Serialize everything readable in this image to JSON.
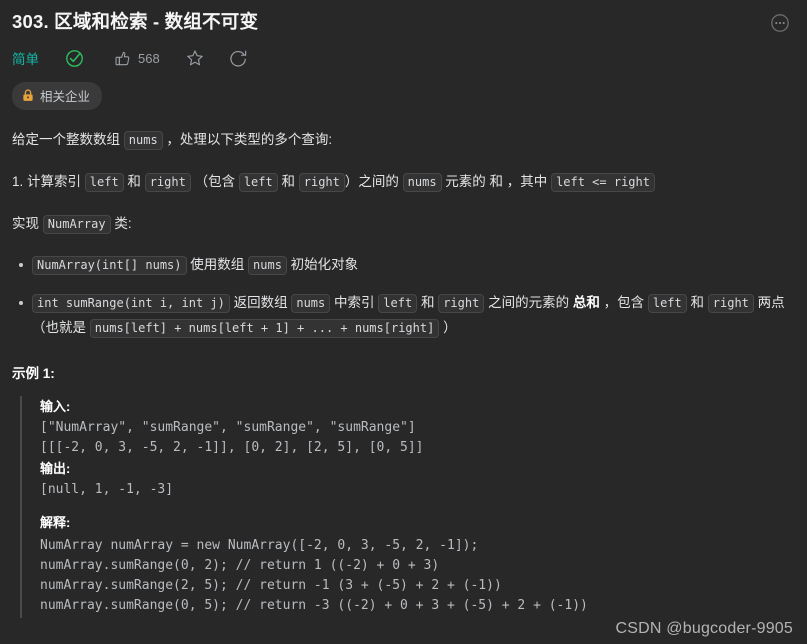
{
  "header": {
    "title": "303. 区域和检索 - 数组不可变",
    "more_icon": "ellipsis-circle-icon"
  },
  "meta": {
    "difficulty": "简单",
    "difficulty_color": "#12b8a6",
    "check_icon": "check-circle-icon",
    "check_color": "#2cbb5d",
    "like_icon": "thumbs-up-icon",
    "like_count": "568",
    "star_icon": "star-icon",
    "share_icon": "share-icon"
  },
  "company_tag": {
    "icon": "lock-icon",
    "icon_color": "#e8a33d",
    "label": "相关企业"
  },
  "description": {
    "intro_a": "给定一个整数数组 ",
    "intro_code": "nums",
    "intro_b": " ，处理以下类型的多个查询:",
    "query_a": "1. 计算索引 ",
    "query_left1": "left",
    "query_b": " 和 ",
    "query_right1": "right",
    "query_c": " （包含 ",
    "query_left2": "left",
    "query_d": " 和 ",
    "query_right2": "right",
    "query_e": "）之间的 ",
    "query_nums": "nums",
    "query_f": " 元素的 和 ，其中 ",
    "query_cond": "left <= right",
    "impl_a": "实现 ",
    "impl_code": "NumArray",
    "impl_b": " 类:"
  },
  "methods": [
    {
      "signature": "NumArray(int[] nums)",
      "text_a": " 使用数组 ",
      "code_b": "nums",
      "text_c": " 初始化对象"
    },
    {
      "signature": "int sumRange(int i, int j)",
      "text_a": " 返回数组 ",
      "code_b": "nums",
      "text_c": " 中索引 ",
      "code_d": "left",
      "text_e": " 和 ",
      "code_f": "right",
      "text_g": " 之间的元素的 ",
      "bold_h": "总和",
      "text_i": " ，包含 ",
      "code_j": "left",
      "text_k": " 和 ",
      "code_l": "right",
      "text_m": " 两点",
      "text_n": "（也就是 ",
      "code_o": "nums[left] + nums[left + 1] + ... + nums[right]",
      "text_p": " ）"
    }
  ],
  "example": {
    "title": "示例 1:",
    "input_label": "输入:",
    "input_code": "[\"NumArray\", \"sumRange\", \"sumRange\", \"sumRange\"]\n[[[-2, 0, 3, -5, 2, -1]], [0, 2], [2, 5], [0, 5]]",
    "output_label": "输出:",
    "output_code": "[null, 1, -1, -3]",
    "explain_label": "解释:",
    "explain_code": "NumArray numArray = new NumArray([-2, 0, 3, -5, 2, -1]);\nnumArray.sumRange(0, 2); // return 1 ((-2) + 0 + 3)\nnumArray.sumRange(2, 5); // return -1 (3 + (-5) + 2 + (-1))\nnumArray.sumRange(0, 5); // return -3 ((-2) + 0 + 3 + (-5) + 2 + (-1))"
  },
  "watermark": "CSDN @bugcoder-9905"
}
